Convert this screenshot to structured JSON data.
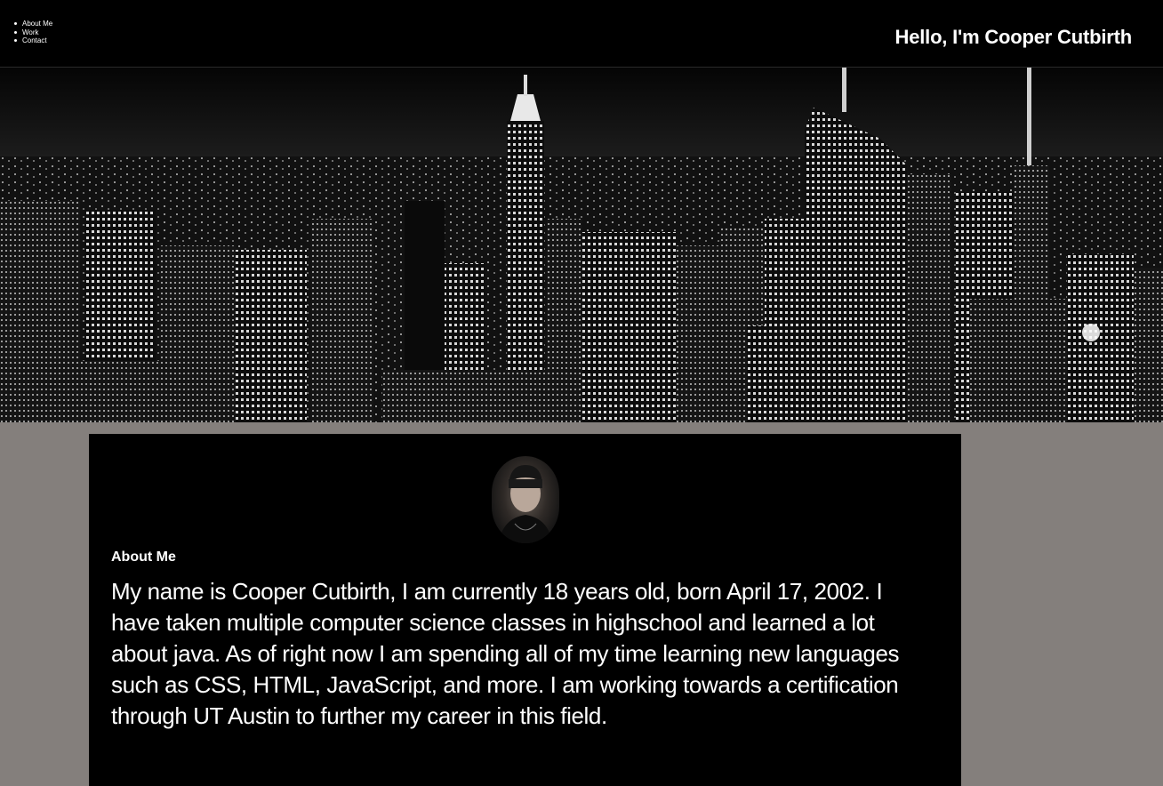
{
  "nav": {
    "items": [
      "About Me",
      "Work",
      "Contact"
    ]
  },
  "header": {
    "title": "Hello, I'm Cooper Cutbirth"
  },
  "hero": {
    "image": "city-skyline-night"
  },
  "about": {
    "heading": "About Me",
    "avatar": "profile-photo",
    "bio": "My name is Cooper Cutbirth, I am currently 18 years old, born April 17, 2002. I have taken multiple computer science classes in highschool and learned a lot about java. As of right now I am spending all of my time learning new languages such as CSS, HTML, JavaScript, and more. I am working towards a certification through UT Austin to further my career in this field."
  },
  "colors": {
    "page_background": "#847f7c",
    "header_background": "#000000",
    "card_background": "#000000",
    "text": "#ffffff"
  }
}
